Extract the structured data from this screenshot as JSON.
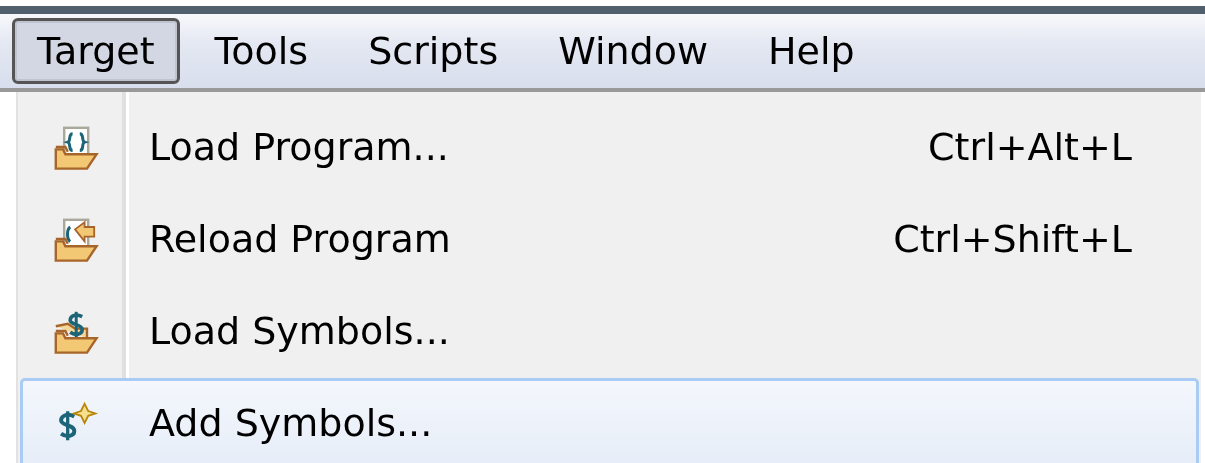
{
  "menu_bar": [
    {
      "label": "Target",
      "selected": true
    },
    {
      "label": "Tools",
      "selected": false
    },
    {
      "label": "Scripts",
      "selected": false
    },
    {
      "label": "Window",
      "selected": false
    },
    {
      "label": "Help",
      "selected": false
    }
  ],
  "menu": {
    "items": [
      {
        "label": "Load Program...",
        "shortcut": "Ctrl+Alt+L",
        "selected": false
      },
      {
        "label": "Reload Program",
        "shortcut": "Ctrl+Shift+L",
        "selected": false
      },
      {
        "label": "Load Symbols...",
        "selected": false
      },
      {
        "label": "Add Symbols...",
        "selected": true
      }
    ]
  }
}
